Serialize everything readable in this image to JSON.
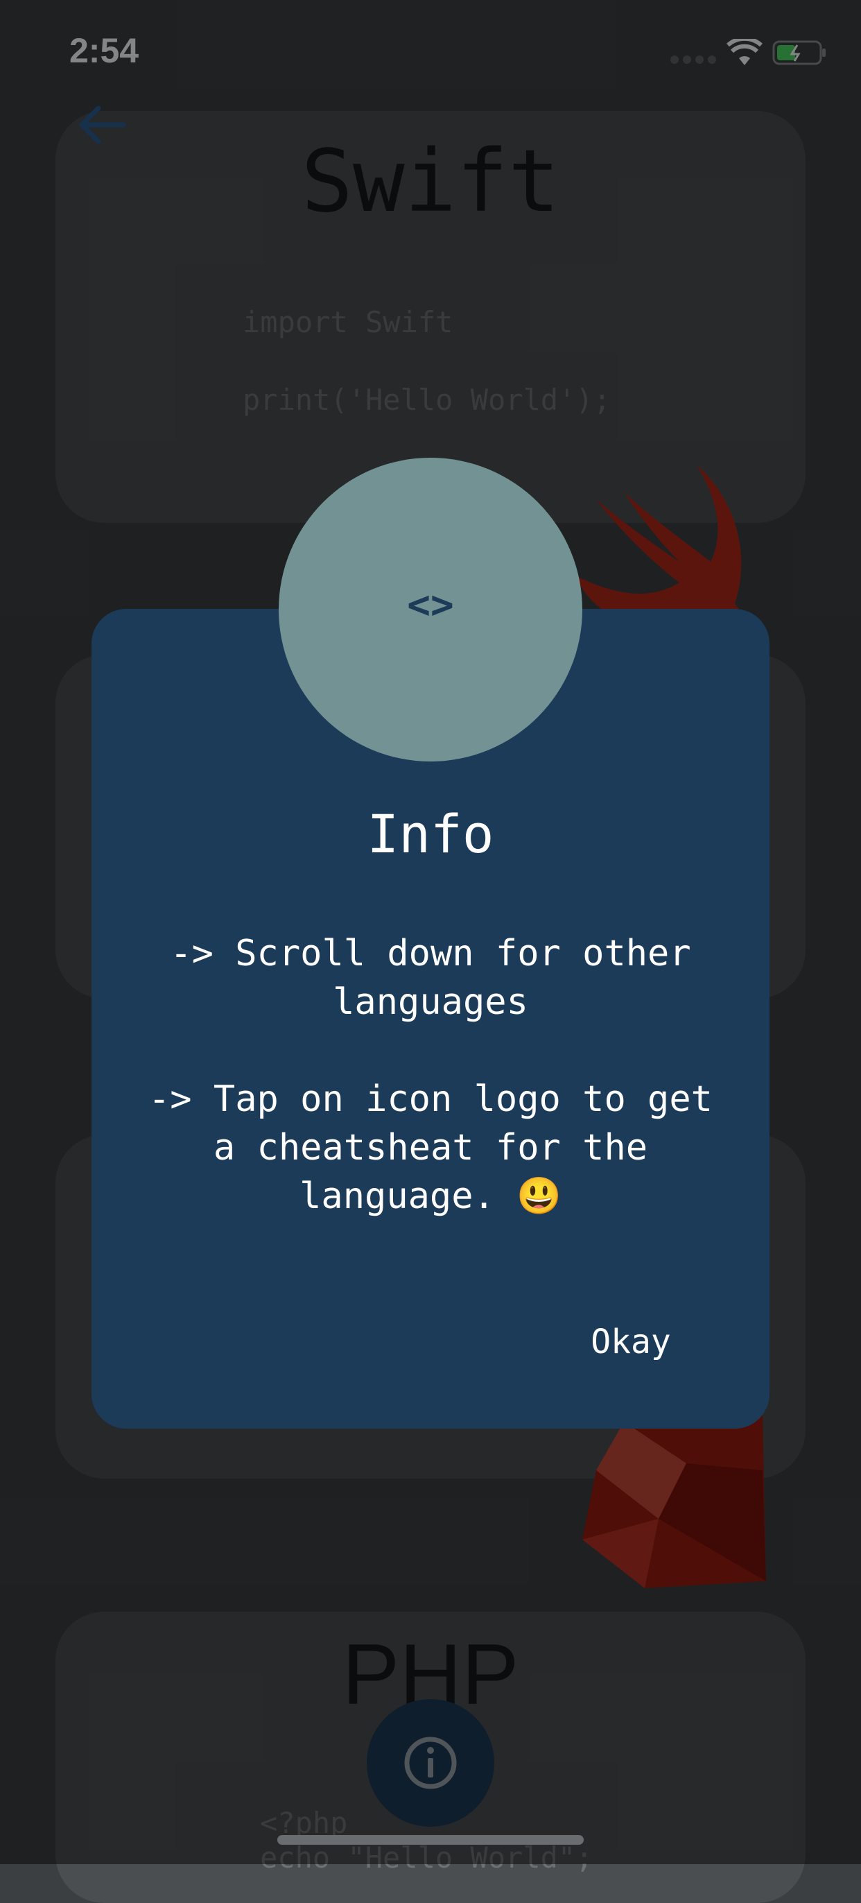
{
  "status_bar": {
    "time": "2:54"
  },
  "cards": [
    {
      "title": "Swift",
      "code": [
        "import Swift",
        "print('Hello World');"
      ]
    },
    {
      "title": "PHP",
      "code": [
        "<?php",
        "echo \"Hello World\";"
      ]
    }
  ],
  "dialog": {
    "title": "Info",
    "body_line1": "-> Scroll down for other",
    "body_line2": "languages",
    "body_line3": "-> Tap on icon logo to get",
    "body_line4": "a cheatsheat for the",
    "body_line5": "language. 😃",
    "okay_label": "Okay",
    "icon_glyph": "<>"
  },
  "icons": {
    "back": "arrow-left-icon",
    "fab": "info-icon",
    "swift_logo": "swift-logo-icon",
    "ruby_logo": "ruby-logo-icon"
  },
  "colors": {
    "background": "#3b3f42",
    "card": "#4a4e51",
    "dialog": "#1c3b59",
    "dialog_circle": "#729293",
    "fab": "#0f1e2c",
    "accent": "#1c4a7a"
  }
}
